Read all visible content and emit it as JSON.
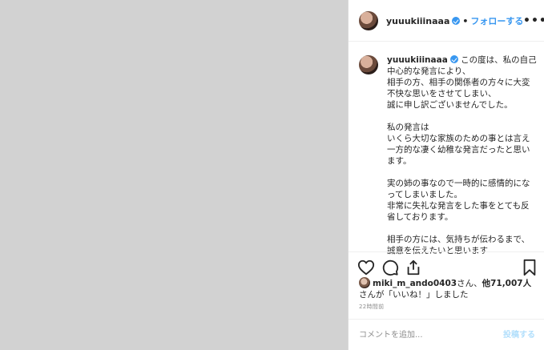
{
  "header": {
    "username": "yuuukiiinaaa",
    "separator": "•",
    "follow_label": "フォローする",
    "more_label": "•••"
  },
  "caption": {
    "username": "yuuukiiinaaa",
    "text": " この度は、私の自己中心的な発言により、\n相手の方、相手の関係者の方々に大変不快な思いをさせてしまい、\n誠に申し訳ございませんでした。\n\n私の発言は\nいくら大切な家族のための事とは言え一方的な凄く幼稚な発言だったと思います。\n\n実の姉の事なので一時的に感情的になってしまいました。\n非常に失礼な発言をした事をとても反省しております。\n\n相手の方には、気持ちが伝わるまで、誠意を伝えたいと思います"
  },
  "likes": {
    "user": "miki_m_ando0403",
    "text_after_user": "さん、",
    "count_text": "他71,007人",
    "line2": "さんが「いいね！」しました"
  },
  "time": "22時間前",
  "comment": {
    "placeholder": "コメントを追加...",
    "post_label": "投稿する"
  },
  "colors": {
    "accent": "#3897f0",
    "post_disabled": "#b2dffc",
    "media_bg": "#d2d2d2"
  },
  "icons": [
    "heart-icon",
    "comment-icon",
    "share-icon",
    "bookmark-icon",
    "verified-icon",
    "more-icon"
  ]
}
